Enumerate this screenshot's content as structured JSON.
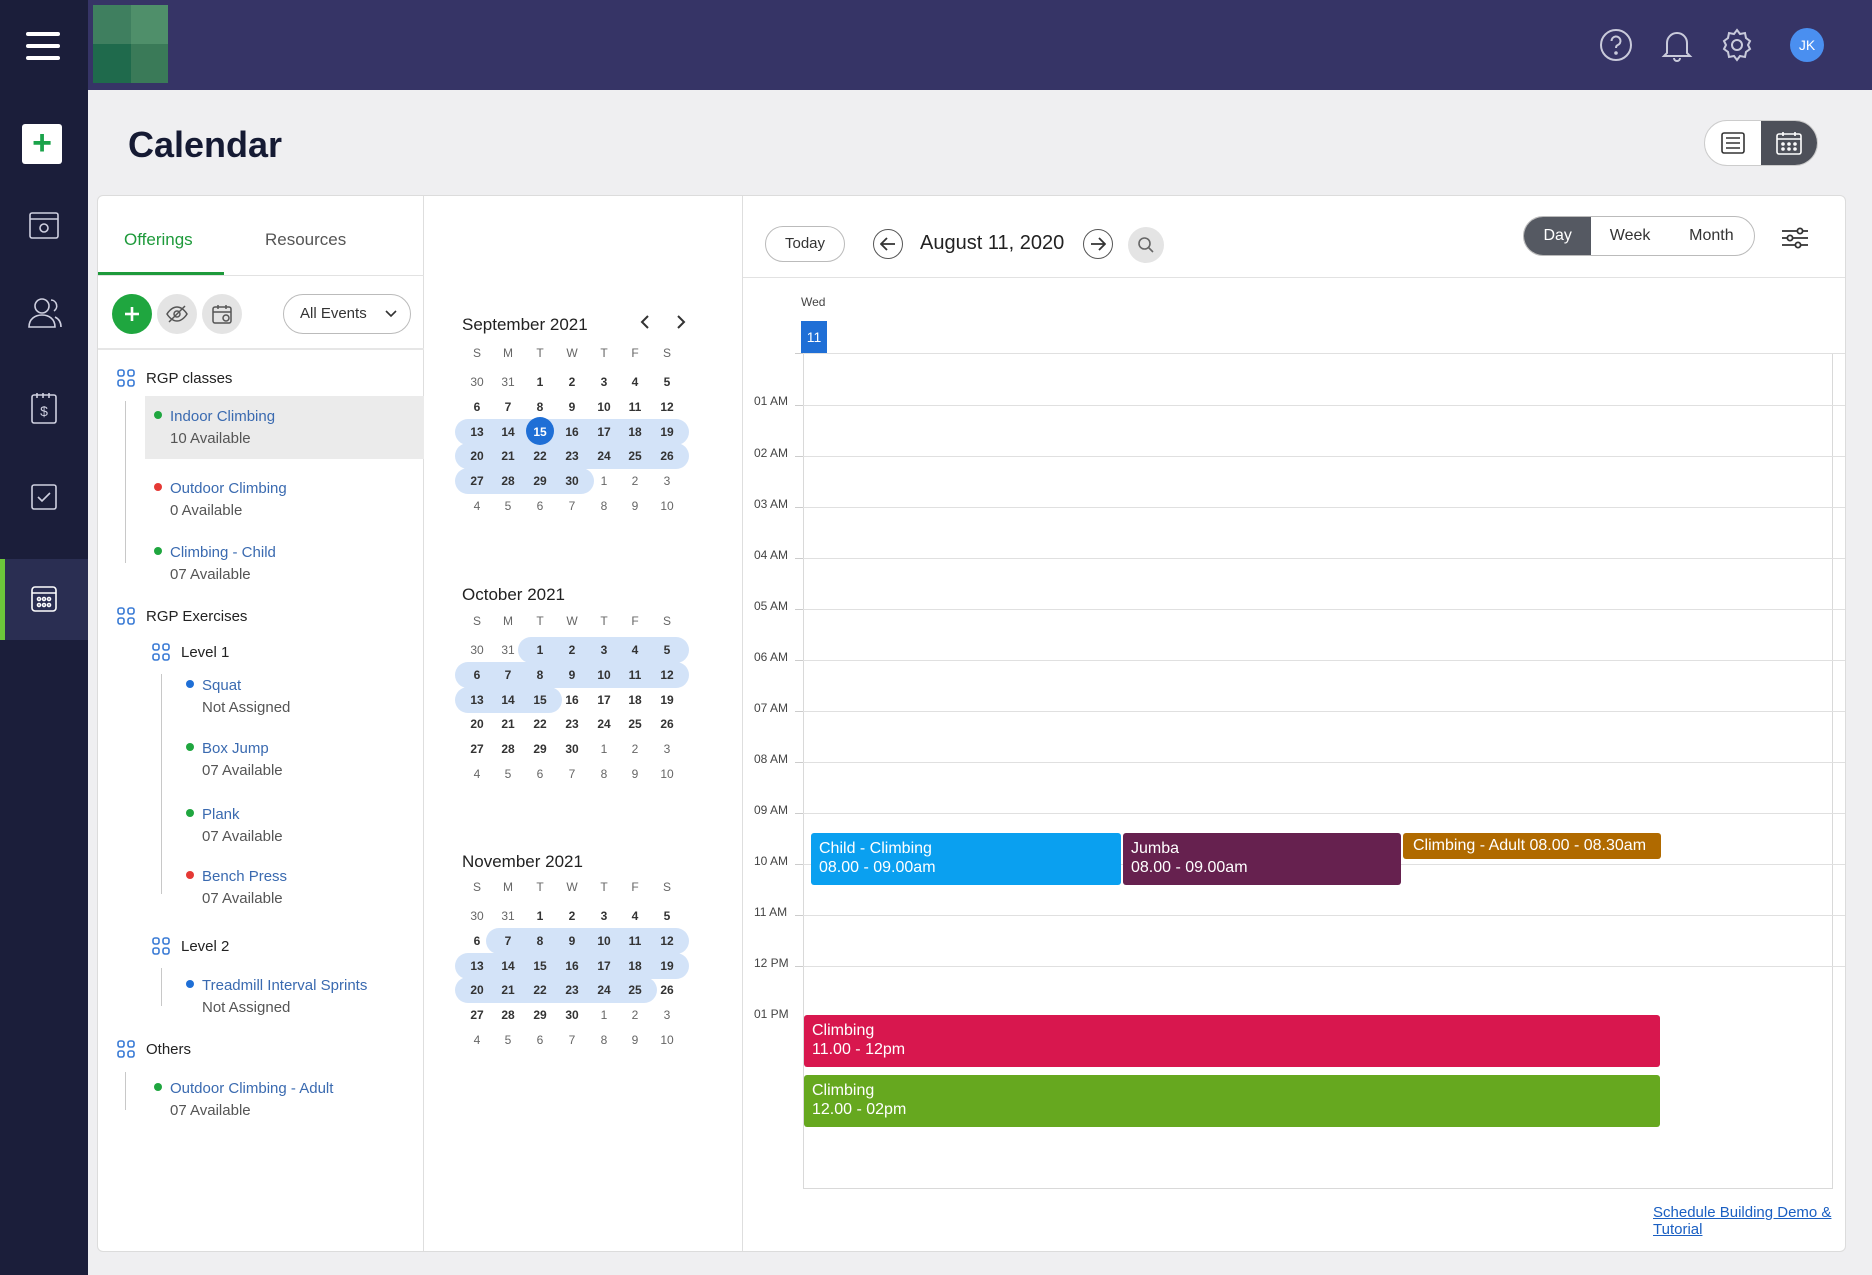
{
  "topbar": {
    "avatar_initials": "JK"
  },
  "page": {
    "title": "Calendar"
  },
  "offerings": {
    "tabs": [
      "Offerings",
      "Resources"
    ],
    "filter": "All Events",
    "groups": [
      {
        "name": "RGP classes",
        "items": [
          {
            "name": "Indoor Climbing",
            "sub": "10 Available",
            "status": "green"
          },
          {
            "name": "Outdoor Climbing",
            "sub": "0 Available",
            "status": "red"
          },
          {
            "name": "Climbing - Child",
            "sub": "07 Available",
            "status": "green"
          }
        ]
      },
      {
        "name": "RGP Exercises",
        "subgroups": [
          {
            "name": "Level 1",
            "items": [
              {
                "name": "Squat",
                "sub": "Not Assigned",
                "status": "blue"
              },
              {
                "name": "Box Jump",
                "sub": "07 Available",
                "status": "green"
              },
              {
                "name": "Plank",
                "sub": "07 Available",
                "status": "green"
              },
              {
                "name": "Bench Press",
                "sub": "07 Available",
                "status": "red"
              }
            ]
          },
          {
            "name": "Level 2",
            "items": [
              {
                "name": "Treadmill Interval Sprints",
                "sub": "Not Assigned",
                "status": "blue"
              }
            ]
          }
        ]
      },
      {
        "name": "Others",
        "items": [
          {
            "name": "Outdoor Climbing - Adult",
            "sub": "07 Available",
            "status": "green"
          }
        ]
      }
    ]
  },
  "mini_calendars": {
    "weekday_headers": [
      "S",
      "M",
      "T",
      "W",
      "T",
      "F",
      "S"
    ],
    "months": [
      {
        "title": "September 2021",
        "today": "15",
        "weeks": [
          [
            "30",
            "31",
            "1",
            "2",
            "3",
            "4",
            "5"
          ],
          [
            "6",
            "7",
            "8",
            "9",
            "10",
            "11",
            "12"
          ],
          [
            "13",
            "14",
            "15",
            "16",
            "17",
            "18",
            "19"
          ],
          [
            "20",
            "21",
            "22",
            "23",
            "24",
            "25",
            "26"
          ],
          [
            "27",
            "28",
            "29",
            "30",
            "1",
            "2",
            "3"
          ],
          [
            "4",
            "5",
            "6",
            "7",
            "8",
            "9",
            "10"
          ]
        ]
      },
      {
        "title": "October 2021",
        "weeks": [
          [
            "30",
            "31",
            "1",
            "2",
            "3",
            "4",
            "5"
          ],
          [
            "6",
            "7",
            "8",
            "9",
            "10",
            "11",
            "12"
          ],
          [
            "13",
            "14",
            "15",
            "16",
            "17",
            "18",
            "19"
          ],
          [
            "20",
            "21",
            "22",
            "23",
            "24",
            "25",
            "26"
          ],
          [
            "27",
            "28",
            "29",
            "30",
            "1",
            "2",
            "3"
          ],
          [
            "4",
            "5",
            "6",
            "7",
            "8",
            "9",
            "10"
          ]
        ]
      },
      {
        "title": "November 2021",
        "weeks": [
          [
            "30",
            "31",
            "1",
            "2",
            "3",
            "4",
            "5"
          ],
          [
            "6",
            "7",
            "8",
            "9",
            "10",
            "11",
            "12"
          ],
          [
            "13",
            "14",
            "15",
            "16",
            "17",
            "18",
            "19"
          ],
          [
            "20",
            "21",
            "22",
            "23",
            "24",
            "25",
            "26"
          ],
          [
            "27",
            "28",
            "29",
            "30",
            "1",
            "2",
            "3"
          ],
          [
            "4",
            "5",
            "6",
            "7",
            "8",
            "9",
            "10"
          ]
        ]
      }
    ]
  },
  "dayview": {
    "today_label": "Today",
    "date_label": "August 11, 2020",
    "views": [
      "Day",
      "Week",
      "Month"
    ],
    "active_view": "Day",
    "weekday": "Wed",
    "day_number": "11",
    "hours": [
      "01 AM",
      "02 AM",
      "03 AM",
      "04 AM",
      "05 AM",
      "06 AM",
      "07 AM",
      "08 AM",
      "09 AM",
      "10 AM",
      "11 AM",
      "12 PM",
      "01 PM"
    ],
    "events": [
      {
        "title": "Child - Climbing",
        "time": "08.00 - 09.00am",
        "color": "#0aa0f0"
      },
      {
        "title": "Jumba",
        "time": "08.00 - 09.00am",
        "color": "#66214f"
      },
      {
        "title": "Climbing - Adult  08.00 - 08.30am",
        "time": "",
        "color": "#b06a00"
      },
      {
        "title": "Climbing",
        "time": "11.00 - 12pm",
        "color": "#d8174e"
      },
      {
        "title": "Climbing",
        "time": "12.00 - 02pm",
        "color": "#66a81f"
      }
    ],
    "demo_link": "Schedule Building Demo & Tutorial"
  }
}
